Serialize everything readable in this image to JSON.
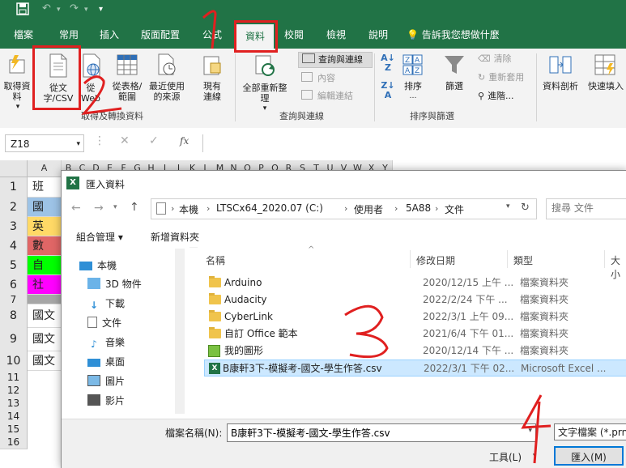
{
  "titlebar": {
    "save_icon": "save-icon",
    "undo_icon": "undo-icon",
    "redo_icon": "redo-icon",
    "customize": "▾"
  },
  "tabs": [
    "檔案",
    "常用",
    "插入",
    "版面配置",
    "公式",
    "資料",
    "校閱",
    "檢視",
    "說明"
  ],
  "tell_me": "告訴我您想做什麼",
  "ribbon": {
    "get_data": "取得資料",
    "from_text": "從文字/CSV",
    "from_web": "從Web",
    "from_table": "從表格/範圍",
    "recent": "最近使用的來源",
    "existing": "現有連線",
    "group1": "取得及轉換資料",
    "refresh_all": "全部重新整理",
    "queries_conn": "查詢與連線",
    "properties": "內容",
    "edit_links": "編輯連結",
    "group2": "查詢與連線",
    "sort": "排序",
    "filter": "篩選",
    "clear": "清除",
    "reapply": "重新套用",
    "advanced": "進階...",
    "group3": "排序與篩選",
    "text_to_columns": "資料剖析",
    "flash_fill": "快速填入"
  },
  "formula_bar": {
    "name_box": "Z18",
    "fx": "fx"
  },
  "sheet": {
    "columns": [
      "A",
      "B",
      "C",
      "D",
      "E",
      "F",
      "G",
      "H",
      "I",
      "J",
      "K",
      "L",
      "M",
      "N",
      "O",
      "P",
      "Q",
      "R",
      "S",
      "T",
      "U",
      "V",
      "W",
      "X",
      "Y"
    ],
    "rows": [
      "1",
      "2",
      "3",
      "4",
      "5",
      "6",
      "7",
      "8",
      "9",
      "10",
      "11",
      "12",
      "13",
      "14",
      "15",
      "16"
    ],
    "cells": [
      {
        "row": "1",
        "text": "班",
        "color": "#ffffff"
      },
      {
        "row": "2",
        "text": "國",
        "color": "#9dc3e6"
      },
      {
        "row": "3",
        "text": "英",
        "color": "#ffd966"
      },
      {
        "row": "4",
        "text": "數",
        "color": "#e06666"
      },
      {
        "row": "5",
        "text": "自",
        "color": "#00ff00"
      },
      {
        "row": "6",
        "text": "社",
        "color": "#ff00ff"
      },
      {
        "row": "7",
        "text": "",
        "color": "#a6a6a6"
      },
      {
        "row": "8",
        "text": "國文",
        "color": "#ffffff"
      },
      {
        "row": "9",
        "text": "國文",
        "color": "#ffffff"
      },
      {
        "row": "10",
        "text": "國文",
        "color": "#ffffff"
      }
    ]
  },
  "dialog": {
    "title": "匯入資料",
    "address": [
      "本機",
      "LTSCx64_2020.07 (C:)",
      "使用者",
      "5A88",
      "文件"
    ],
    "search_placeholder": "搜尋 文件",
    "organize": "組合管理 ▾",
    "new_folder": "新增資料夾",
    "nav_items": [
      "本機",
      "3D 物件",
      "下載",
      "文件",
      "音樂",
      "桌面",
      "圖片",
      "影片"
    ],
    "headers": {
      "name": "名稱",
      "date": "修改日期",
      "type": "類型",
      "size": "大小"
    },
    "files": [
      {
        "name": "Arduino",
        "date": "2020/12/15 上午 ...",
        "type": "檔案資料夾",
        "kind": "folder"
      },
      {
        "name": "Audacity",
        "date": "2022/2/24 下午 ...",
        "type": "檔案資料夾",
        "kind": "folder"
      },
      {
        "name": "CyberLink",
        "date": "2022/3/1 上午 09...",
        "type": "檔案資料夾",
        "kind": "folder"
      },
      {
        "name": "自訂 Office 範本",
        "date": "2021/6/4 下午 01...",
        "type": "檔案資料夾",
        "kind": "folder"
      },
      {
        "name": "我的圖形",
        "date": "2020/12/14 下午 ...",
        "type": "檔案資料夾",
        "kind": "shapes"
      },
      {
        "name": "B康軒3下-模擬考-國文-學生作答.csv",
        "date": "2022/3/1 下午 02...",
        "type": "Microsoft Excel ...",
        "kind": "csv"
      }
    ],
    "filename_label": "檔案名稱(N):",
    "filename_value": "B康軒3下-模擬考-國文-學生作答.csv",
    "filetype": "文字檔案 (*.prn;",
    "tools": "工具(L)",
    "import": "匯入(M)"
  },
  "annotations": [
    "1",
    "2",
    "3",
    "4"
  ],
  "colors": {
    "excel_green": "#217346",
    "annotation_red": "#e02020",
    "selection": "#cce8ff"
  }
}
